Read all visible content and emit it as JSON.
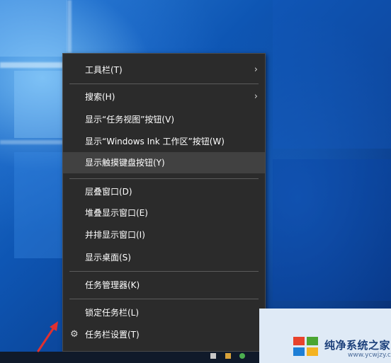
{
  "context_menu": {
    "items": [
      {
        "label": "工具栏(T)",
        "submenu": true
      },
      {
        "label": "搜索(H)",
        "submenu": true
      },
      {
        "label": "显示“任务视图”按钮(V)"
      },
      {
        "label": "显示“Windows Ink 工作区”按钮(W)"
      },
      {
        "label": "显示触摸键盘按钮(Y)",
        "highlighted": true
      },
      {
        "label": "层叠窗口(D)"
      },
      {
        "label": "堆叠显示窗口(E)"
      },
      {
        "label": "并排显示窗口(I)"
      },
      {
        "label": "显示桌面(S)"
      },
      {
        "label": "任务管理器(K)"
      },
      {
        "label": "锁定任务栏(L)"
      },
      {
        "label": "任务栏设置(T)",
        "icon": "gear-icon"
      }
    ],
    "chevron_glyph": "›",
    "gear_glyph": "⚙"
  },
  "watermark": {
    "title": "纯净系统之家",
    "url": "www.ycwjzy.com"
  },
  "colors": {
    "menu_bg": "#2b2b2b",
    "menu_highlight": "#414141",
    "arrow": "#e03030",
    "desktop": "#0e56b4"
  }
}
